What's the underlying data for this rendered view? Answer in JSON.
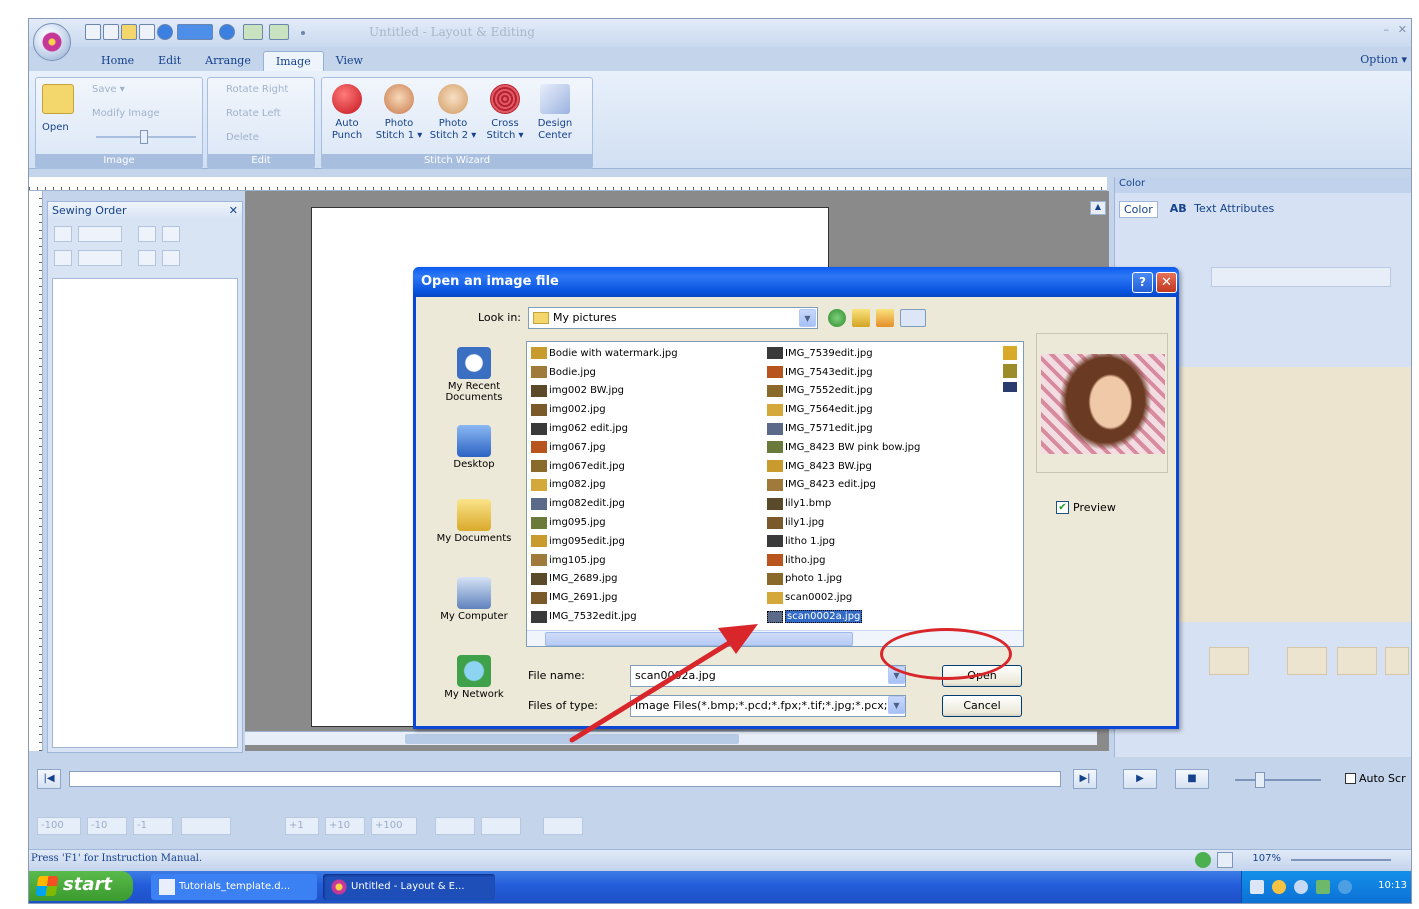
{
  "window": {
    "title": "Untitled - Layout & Editing",
    "min": "–",
    "close": "✕"
  },
  "tabs": [
    {
      "label": "Home"
    },
    {
      "label": "Edit"
    },
    {
      "label": "Arrange"
    },
    {
      "label": "Image",
      "active": true
    },
    {
      "label": "View"
    }
  ],
  "option_label": "Option ▾",
  "ribbon": {
    "image_group": {
      "label": "Image",
      "open_label": "Open",
      "save_label": "Save ▾",
      "modify_label": "Modify Image"
    },
    "edit_group": {
      "label": "Edit",
      "rotate_right": "Rotate Right",
      "rotate_left": "Rotate Left",
      "delete": "Delete"
    },
    "stitch_group": {
      "label": "Stitch Wizard",
      "buttons": [
        {
          "line1": "Auto",
          "line2": "Punch",
          "icon": "apple-icon",
          "color": "#d8232a"
        },
        {
          "line1": "Photo",
          "line2": "Stitch 1 ▾",
          "icon": "photo-stitch-1-icon",
          "color": "#e8a06a"
        },
        {
          "line1": "Photo",
          "line2": "Stitch 2 ▾",
          "icon": "photo-stitch-2-icon",
          "color": "#e8b47a"
        },
        {
          "line1": "Cross",
          "line2": "Stitch ▾",
          "icon": "cross-stitch-icon",
          "color": "#c83a48"
        },
        {
          "line1": "Design",
          "line2": "Center",
          "icon": "design-center-icon",
          "color": "#8fa8d8"
        }
      ]
    }
  },
  "sewing_order": {
    "title": "Sewing Order",
    "close": "✕"
  },
  "color_panel": {
    "header": "Color",
    "tab_color": "Color",
    "tab_text": "Text Attributes",
    "tab_text_prefix": "AB"
  },
  "player": {
    "first": "|◀",
    "last": "▶|",
    "play": "▶",
    "stop": "■",
    "auto_scroll": "Auto Scr"
  },
  "jump_buttons": [
    "-100",
    "-10",
    "-1",
    "",
    "+1",
    "+10",
    "+100"
  ],
  "status": {
    "text": "Press 'F1' for Instruction Manual.",
    "zoom": "107%"
  },
  "taskbar": {
    "start": "start",
    "tasks": [
      {
        "label": "Tutorials_template.d...",
        "icon": "word-doc-icon"
      },
      {
        "label": "Untitled - Layout & E...",
        "icon": "pe-design-icon"
      }
    ],
    "clock": "10:13"
  },
  "dialog": {
    "title": "Open an image file",
    "help": "?",
    "close": "✕",
    "look_in_label": "Look in:",
    "look_in_value": "My pictures",
    "places": [
      {
        "label": "My Recent Documents",
        "icon": "recent-documents-icon",
        "color": "#3b6fc2"
      },
      {
        "label": "Desktop",
        "icon": "desktop-icon",
        "color": "#3f7fd9"
      },
      {
        "label": "My Documents",
        "icon": "my-documents-icon",
        "color": "#e9c443"
      },
      {
        "label": "My Computer",
        "icon": "my-computer-icon",
        "color": "#6a8cc4"
      },
      {
        "label": "My Network",
        "icon": "my-network-icon",
        "color": "#3fa24a"
      }
    ],
    "files_col1": [
      "Bodie with watermark.jpg",
      "Bodie.jpg",
      "img002 BW.jpg",
      "img002.jpg",
      "img062 edit.jpg",
      "img067.jpg",
      "img067edit.jpg",
      "img082.jpg",
      "img082edit.jpg",
      "img095.jpg",
      "img095edit.jpg",
      "img105.jpg",
      "IMG_2689.jpg",
      "IMG_2691.jpg",
      "IMG_7532edit.jpg"
    ],
    "files_col2": [
      "IMG_7539edit.jpg",
      "IMG_7543edit.jpg",
      "IMG_7552edit.jpg",
      "IMG_7564edit.jpg",
      "IMG_7571edit.jpg",
      "IMG_8423 BW pink bow.jpg",
      "IMG_8423 BW.jpg",
      "IMG_8423 edit.jpg",
      "lily1.bmp",
      "lily1.jpg",
      "litho 1.jpg",
      "litho.jpg",
      "photo 1.jpg",
      "scan0002.jpg",
      "scan0002a.jpg"
    ],
    "selected_file": "scan0002a.jpg",
    "preview_label": "Preview",
    "file_name_label": "File name:",
    "file_name_value": "scan0002a.jpg",
    "file_type_label": "Files of type:",
    "file_type_value": "Image Files(*.bmp;*.pcd;*.fpx;*.tif;*.jpg;*.pcx;*.w",
    "open_button": "Open",
    "cancel_button": "Cancel"
  },
  "colors": {
    "dialog_title": "#0a5af0",
    "annotation": "#d9262a",
    "selection": "#316ac5"
  }
}
